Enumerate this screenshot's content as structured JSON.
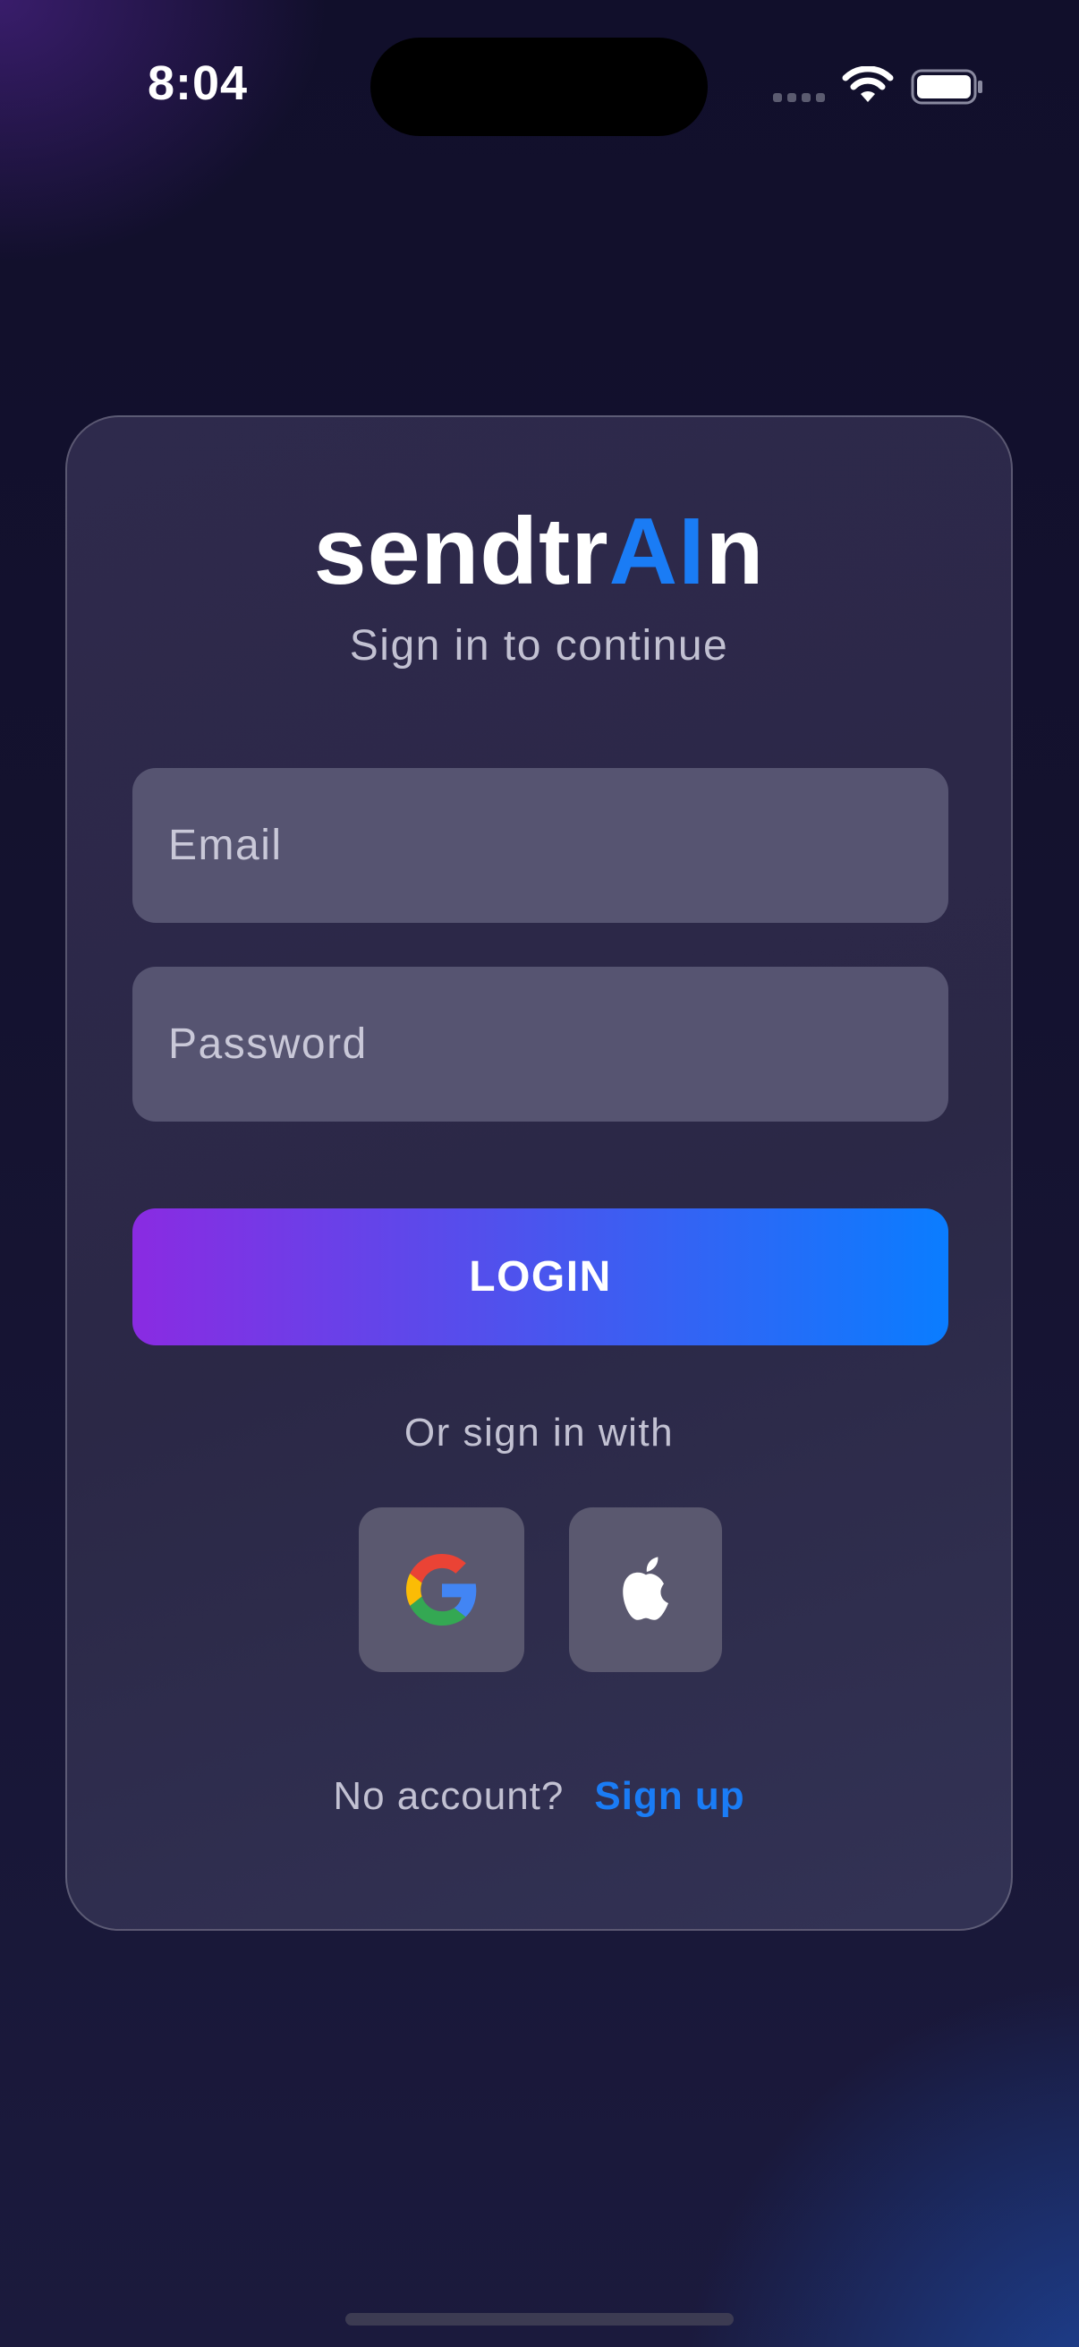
{
  "status_bar": {
    "time": "8:04",
    "icons": [
      "cellular-signal-icon",
      "wifi-icon",
      "battery-icon"
    ]
  },
  "brand": {
    "name_prefix": "sendtr",
    "name_accent": "AI",
    "name_suffix": "n",
    "accent_color": "#1a7cf5"
  },
  "login": {
    "subtitle": "Sign in to continue",
    "email_placeholder": "Email",
    "password_placeholder": "Password",
    "login_button": "LOGIN",
    "alt_text": "Or sign in with",
    "social_icons": [
      "google-icon",
      "apple-icon"
    ],
    "no_account_text": "No account?",
    "signup_link": "Sign up"
  },
  "colors": {
    "button_gradient_start": "#8a2be2",
    "button_gradient_end": "#0a7dff",
    "card_background": "#2e2b4c",
    "field_background": "#565471"
  }
}
